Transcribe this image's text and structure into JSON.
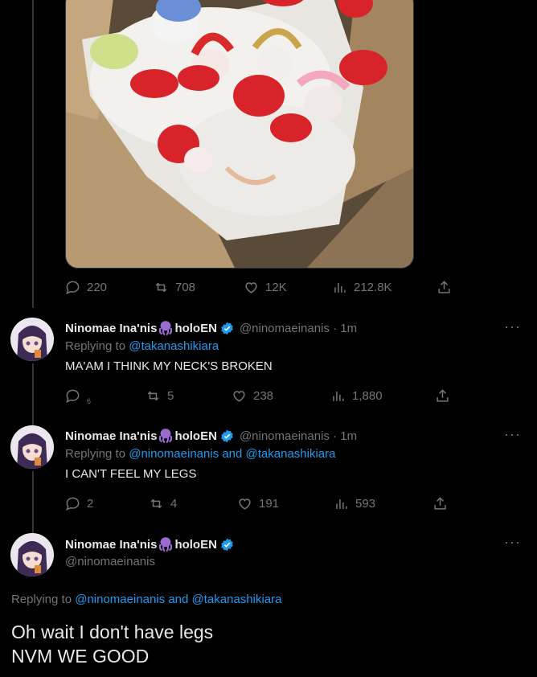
{
  "media": {
    "alt": ""
  },
  "top_actions": {
    "replies": "220",
    "retweets": "708",
    "likes": "12K",
    "views": "212.8K"
  },
  "tweets": [
    {
      "name": "Ninomae Ina'nis",
      "name_suffix": "holoEN",
      "handle": "@ninomaeinanis · 1m",
      "replying_prefix": "Replying to ",
      "replying_to": "@takanashikiara",
      "text": "MA'AM I THINK MY NECK'S BROKEN",
      "replies": "6",
      "retweets": "5",
      "likes": "238",
      "views": "1,880"
    },
    {
      "name": "Ninomae Ina'nis",
      "name_suffix": "holoEN",
      "handle": "@ninomaeinanis · 1m",
      "replying_prefix": "Replying to ",
      "replying_to": "@ninomaeinanis and @takanashikiara",
      "text": "I CAN'T FEEL MY LEGS",
      "replies": "2",
      "retweets": "4",
      "likes": "191",
      "views": "593"
    }
  ],
  "main_tweet": {
    "name": "Ninomae Ina'nis",
    "name_suffix": "holoEN",
    "handle": "@ninomaeinanis",
    "replying_prefix": "Replying to ",
    "replying_to": "@ninomaeinanis and @takanashikiara",
    "text_line1": "Oh wait I don't have legs",
    "text_line2": "NVM WE GOOD"
  },
  "more_label": "···"
}
